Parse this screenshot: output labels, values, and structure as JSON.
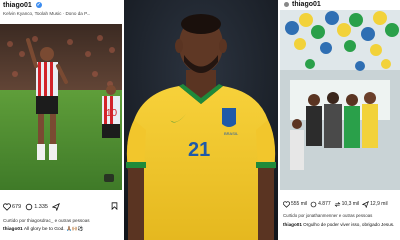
{
  "panels": {
    "left": {
      "username": "thiago01",
      "subtitle": "Kelvin Kyanco, Toolah Music · Dono da P...",
      "player_number": "10",
      "actions": {
        "likes": "679",
        "comments": "1.335"
      },
      "liked_by": "Curtido por thiagosdrac_ e outras pessoas",
      "caption_user": "thiago01",
      "caption_text": "All glory be to God. 🙏🏽🙌🏼⚽️"
    },
    "center": {
      "jersey_number": "21",
      "brand": "BRASIL"
    },
    "right": {
      "username": "thiago01",
      "actions": {
        "likes": "555 mil",
        "comments": "4.877",
        "reposts": "10,3 mil",
        "shares": "12,9 mil"
      },
      "liked_by": "Curtido por jonathanmenner e outras pessoas",
      "caption_user": "thiago01",
      "caption_text": "Orgulho de poder viver isso, obrigado Jesus."
    }
  }
}
